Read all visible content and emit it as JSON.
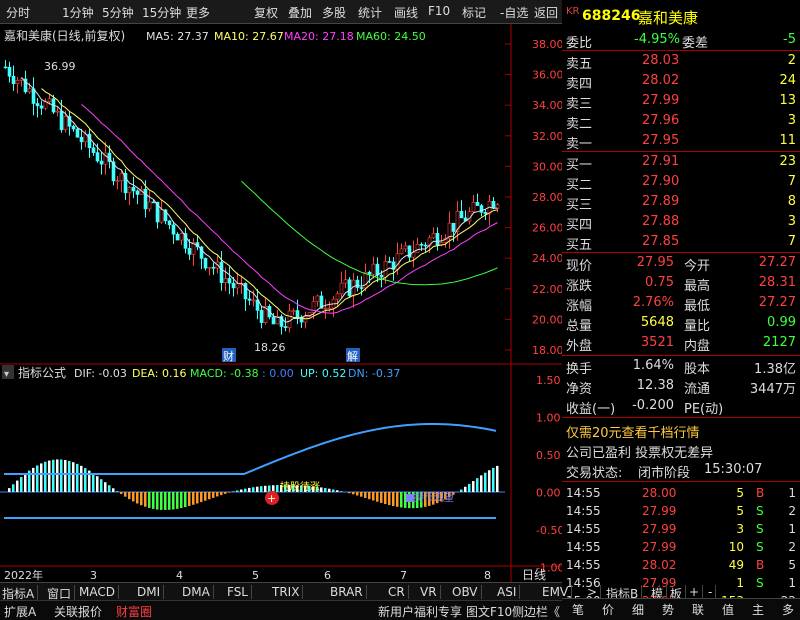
{
  "toolbar": {
    "items": [
      "分时",
      "1分钟",
      "5分钟",
      "15分钟",
      "更多",
      "复权",
      "叠加",
      "多股",
      "统计",
      "画线",
      "F10",
      "标记",
      "-自选",
      "返回"
    ]
  },
  "stock": {
    "badge": "KR",
    "code": "688246",
    "name": "嘉和美康"
  },
  "chart_header": {
    "title": "嘉和美康(日线,前复权)",
    "ma5": "MA5: 27.37",
    "ma10": "MA10: 27.67",
    "ma20": "MA20: 27.18",
    "ma60": "MA60: 24.50",
    "high_label": "36.99",
    "low_label": "18.26",
    "marker1": "财",
    "marker2": "解",
    "y_ticks": [
      "38.00",
      "36.00",
      "34.00",
      "32.00",
      "30.00",
      "28.00",
      "26.00",
      "24.00",
      "22.00",
      "20.00",
      "18.00"
    ]
  },
  "indicator": {
    "title": "指标公式",
    "dif": "DIF: -0.03",
    "dea": "DEA: 0.16",
    "macd": "MACD: -0.38",
    "zero": ": 0.00",
    "up": "UP: 0.52",
    "dn": "DN: -0.37",
    "y_ticks": [
      "1.50",
      "1.00",
      "0.50",
      "0.00",
      "-0.50",
      "-1.00"
    ],
    "buy_label": "持股待涨",
    "sell_label": "持币观望"
  },
  "x_axis": {
    "labels": [
      "2022年",
      "3",
      "4",
      "5",
      "6",
      "7",
      "8"
    ],
    "period": "日线"
  },
  "indicator_tabs": [
    "指标A",
    "窗口",
    "MACD",
    "DMI",
    "DMA",
    "FSL",
    "TRIX",
    "BRAR",
    "CR",
    "VR",
    "OBV",
    "ASI",
    "EMV",
    ">",
    "指标B",
    "模",
    "板",
    "+",
    "-"
  ],
  "bottom_tabs": [
    "扩展A",
    "关联报价",
    "财富圈"
  ],
  "bottom_right": [
    "新用户福利专享",
    "图文F10",
    "侧边栏《"
  ],
  "quote": {
    "weibi_label": "委比",
    "weibi": "-4.95%",
    "weicha_label": "委差",
    "weicha": "-5",
    "asks": [
      {
        "label": "卖五",
        "price": "28.03",
        "vol": "2"
      },
      {
        "label": "卖四",
        "price": "28.02",
        "vol": "24"
      },
      {
        "label": "卖三",
        "price": "27.99",
        "vol": "13"
      },
      {
        "label": "卖二",
        "price": "27.96",
        "vol": "3"
      },
      {
        "label": "卖一",
        "price": "27.95",
        "vol": "11"
      }
    ],
    "bids": [
      {
        "label": "买一",
        "price": "27.91",
        "vol": "23"
      },
      {
        "label": "买二",
        "price": "27.90",
        "vol": "7"
      },
      {
        "label": "买三",
        "price": "27.89",
        "vol": "8"
      },
      {
        "label": "买四",
        "price": "27.88",
        "vol": "3"
      },
      {
        "label": "买五",
        "price": "27.85",
        "vol": "7"
      }
    ],
    "stats": [
      {
        "l1": "现价",
        "v1": "27.95",
        "l2": "今开",
        "v2": "27.27"
      },
      {
        "l1": "涨跌",
        "v1": "0.75",
        "l2": "最高",
        "v2": "28.31"
      },
      {
        "l1": "涨幅",
        "v1": "2.76%",
        "l2": "最低",
        "v2": "27.27"
      },
      {
        "l1": "总量",
        "v1": "5648",
        "l2": "量比",
        "v2": "0.99"
      },
      {
        "l1": "外盘",
        "v1": "3521",
        "l2": "内盘",
        "v2": "2127"
      }
    ],
    "fin": [
      {
        "l1": "换手",
        "v1": "1.64%",
        "l2": "股本",
        "v2": "1.38亿"
      },
      {
        "l1": "净资",
        "v1": "12.38",
        "l2": "流通",
        "v2": "3447万"
      },
      {
        "l1": "收益(一)",
        "v1": "-0.200",
        "l2": "PE(动)",
        "v2": ""
      }
    ],
    "promo1": "仅需20元查看千档行情",
    "promo2": "公司已盈利 投票权无差异",
    "status_label": "交易状态:",
    "status": "闭市阶段",
    "status_time": "15:30:07"
  },
  "ticks": [
    {
      "time": "14:55",
      "price": "28.00",
      "vol": "5",
      "bs": "B",
      "n": "1"
    },
    {
      "time": "14:55",
      "price": "27.99",
      "vol": "5",
      "bs": "S",
      "n": "2"
    },
    {
      "time": "14:55",
      "price": "27.99",
      "vol": "3",
      "bs": "S",
      "n": "1"
    },
    {
      "time": "14:55",
      "price": "27.99",
      "vol": "10",
      "bs": "S",
      "n": "2"
    },
    {
      "time": "14:55",
      "price": "28.02",
      "vol": "49",
      "bs": "B",
      "n": "5"
    },
    {
      "time": "14:56",
      "price": "27.99",
      "vol": "1",
      "bs": "S",
      "n": "1"
    },
    {
      "time": "15:00",
      "price": "27.95",
      "vol": "153",
      "bs": "",
      "n": "22"
    }
  ],
  "right_tabs": [
    "笔",
    "价",
    "细",
    "势",
    "联",
    "值",
    "主",
    "多"
  ]
}
